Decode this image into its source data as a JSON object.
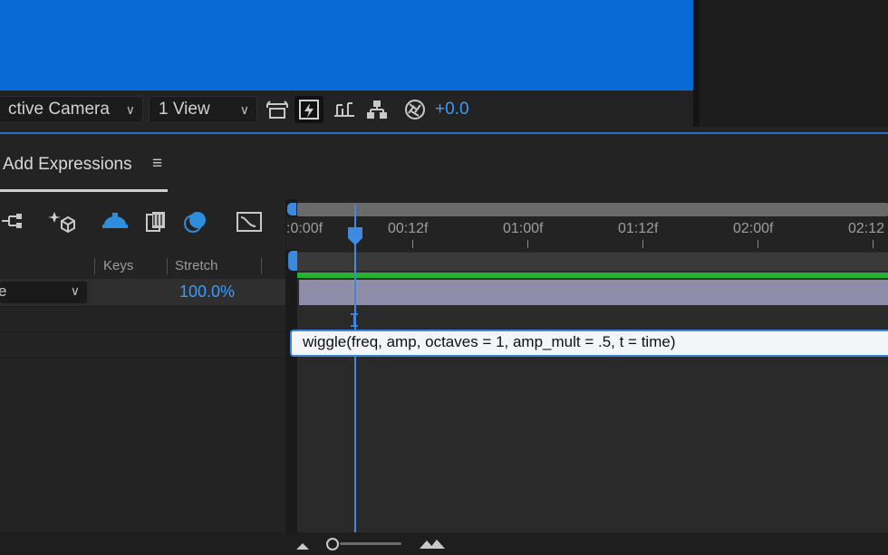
{
  "viewer": {
    "camera_dropdown": "ctive Camera",
    "view_dropdown": "1 View",
    "exposure_value": "+0.0",
    "background_color": "#0a6ad5"
  },
  "timeline": {
    "panel_title": "Add Expressions",
    "menu_glyph": "≡",
    "columns": {
      "keys": "Keys",
      "stretch": "Stretch"
    },
    "layer": {
      "stretch_value": "100.0%"
    },
    "ruler_labels": [
      ":0:00f",
      "00:12f",
      "01:00f",
      "01:12f",
      "02:00f",
      "02:12"
    ],
    "expression_hint": "wiggle(freq, amp, octaves = 1, amp_mult = .5, t = time)"
  },
  "colors": {
    "accent_blue": "#3a9bff",
    "green_bar": "#22b431",
    "layer_bar": "#8e8ca6"
  }
}
